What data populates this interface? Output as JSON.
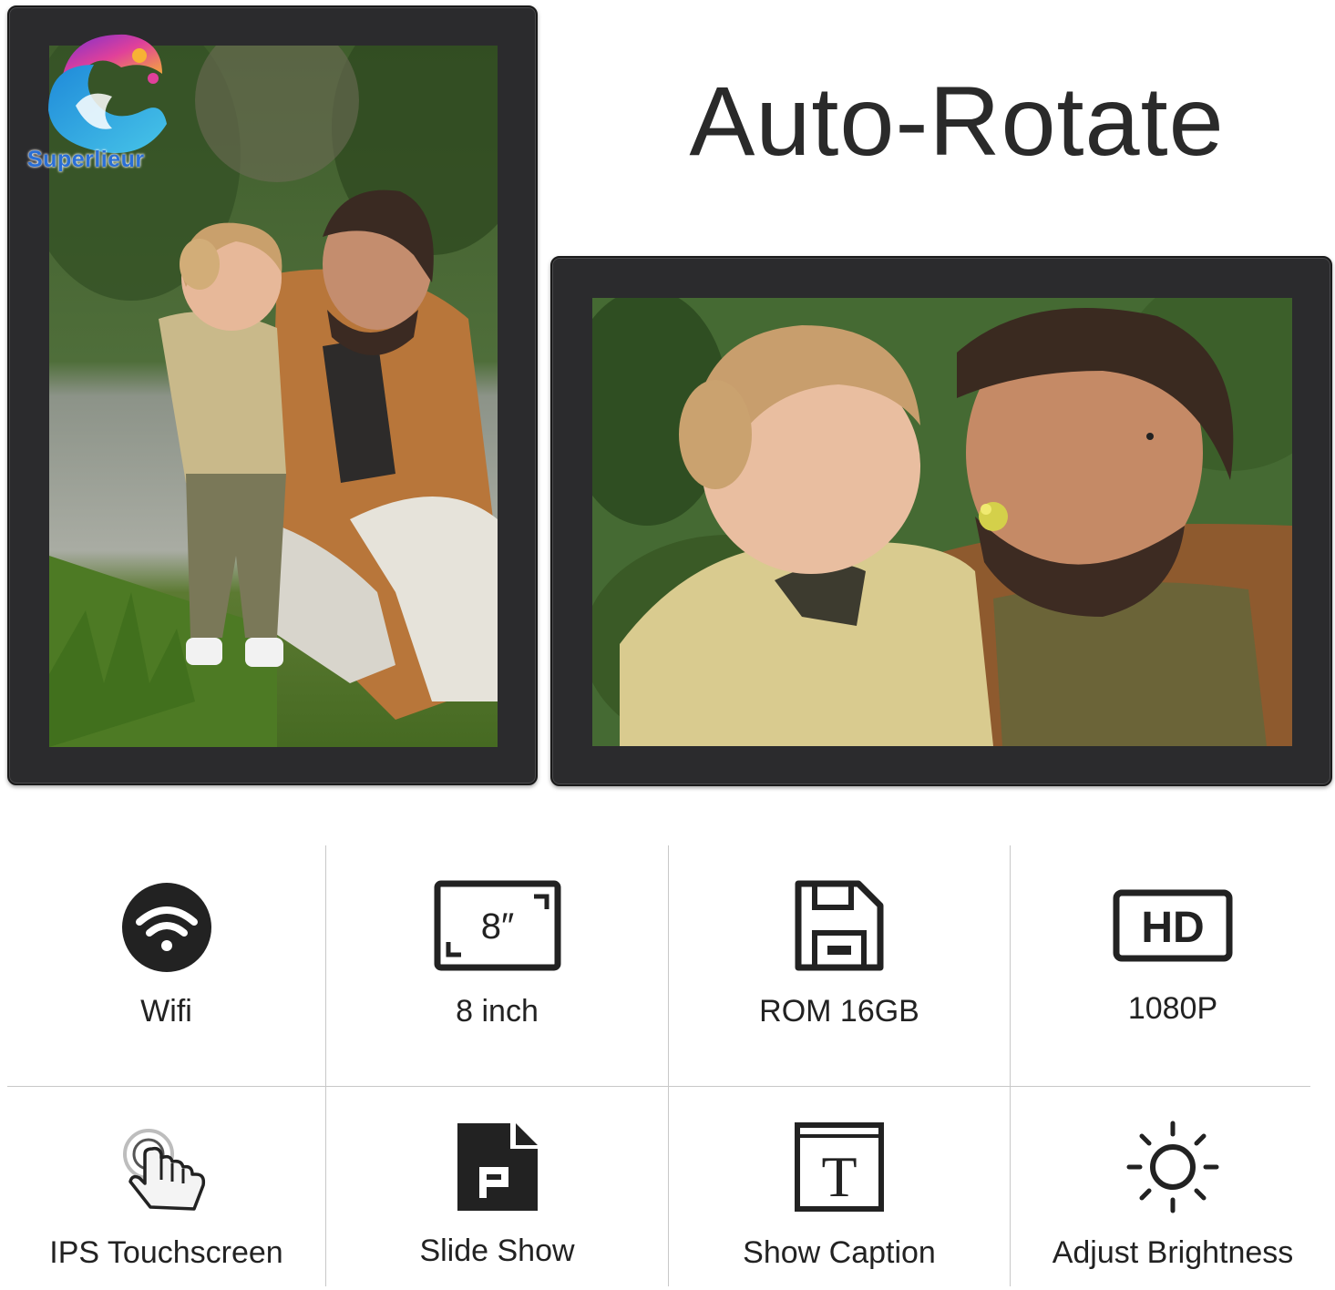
{
  "brand": {
    "logo_text": "Superlieur"
  },
  "headline": "Auto-Rotate",
  "features": [
    {
      "label": "Wifi",
      "icon": "wifi-icon"
    },
    {
      "label": "8 inch",
      "icon": "screen-size-icon",
      "icon_text": "8″"
    },
    {
      "label": "ROM 16GB",
      "icon": "floppy-disk-icon"
    },
    {
      "label": "1080P",
      "icon": "hd-icon",
      "icon_text": "HD"
    },
    {
      "label": "IPS Touchscreen",
      "icon": "touch-hand-icon"
    },
    {
      "label": "Slide Show",
      "icon": "slideshow-file-icon"
    },
    {
      "label": "Show Caption",
      "icon": "caption-text-icon",
      "icon_text": "T"
    },
    {
      "label": "Adjust Brightness",
      "icon": "brightness-icon"
    }
  ],
  "colors": {
    "frame": "#2b2b2d",
    "logo_text": "#2a6fd6",
    "divider": "#c8c8c8",
    "text": "#222222"
  }
}
